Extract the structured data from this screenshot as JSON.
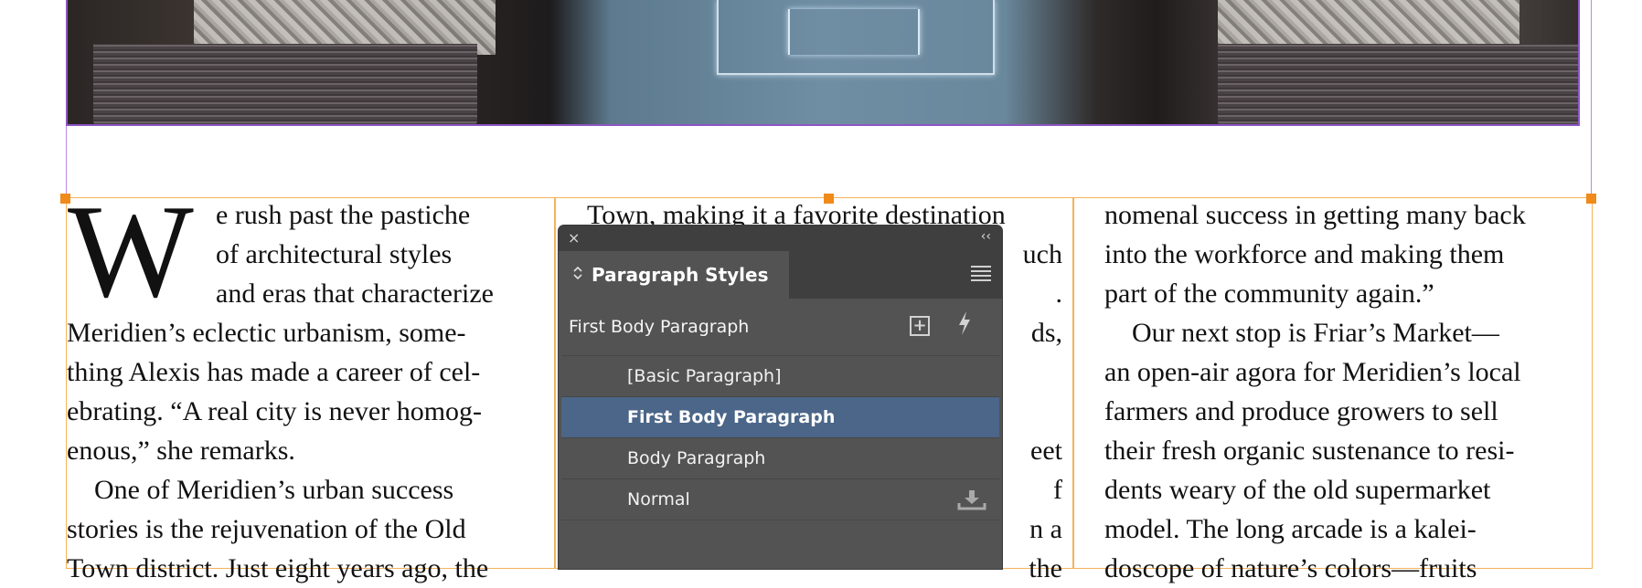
{
  "document": {
    "dropcap": "W",
    "column1": [
      "e rush past the pastiche",
      "of architectural styles",
      "and eras that characterize",
      "Meridien’s eclectic urbanism, some-",
      "thing Alexis has made a career of cel-",
      "ebrating. “A real city is never homog-",
      "enous,” she remarks.",
      "    One of Meridien’s urban success",
      "stories is the rejuvenation of the Old",
      "Town district. Just eight years ago, the"
    ],
    "column2": [
      "Town, making it a favorite destination",
      "uch",
      ".",
      "ds,",
      "",
      "",
      "eet",
      "f",
      "n a",
      "the"
    ],
    "column3": [
      "nomenal success in getting many back",
      "into the workforce and making them",
      "part of the community again.”",
      "    Our next stop is Friar’s Market—",
      "an open-air agora for Meridien’s local",
      "farmers and produce growers to sell",
      "their fresh organic sustenance to resi-",
      "dents weary of the old supermarket",
      "model. The long arcade is a kalei-",
      "doscope of nature’s colors—fruits"
    ]
  },
  "panel": {
    "title": "Paragraph Styles",
    "close_glyph": "×",
    "collapse_glyph": "‹‹",
    "current_style": "First Body Paragraph",
    "styles": [
      {
        "label": "[Basic Paragraph]",
        "selected": false
      },
      {
        "label": "First Body Paragraph",
        "selected": true
      },
      {
        "label": "Body Paragraph",
        "selected": false
      },
      {
        "label": "Normal",
        "selected": false
      }
    ],
    "icons": {
      "new_style": "new-style-icon",
      "quick_apply": "lightning-icon",
      "imported": "download-icon",
      "menu": "panel-menu-icon"
    }
  },
  "colors": {
    "frame_orange": "#f4b25a",
    "handle_orange": "#f08a1a",
    "image_frame_purple": "#8d56c4",
    "panel_bg": "#535353",
    "selection_blue": "#4b6688"
  }
}
